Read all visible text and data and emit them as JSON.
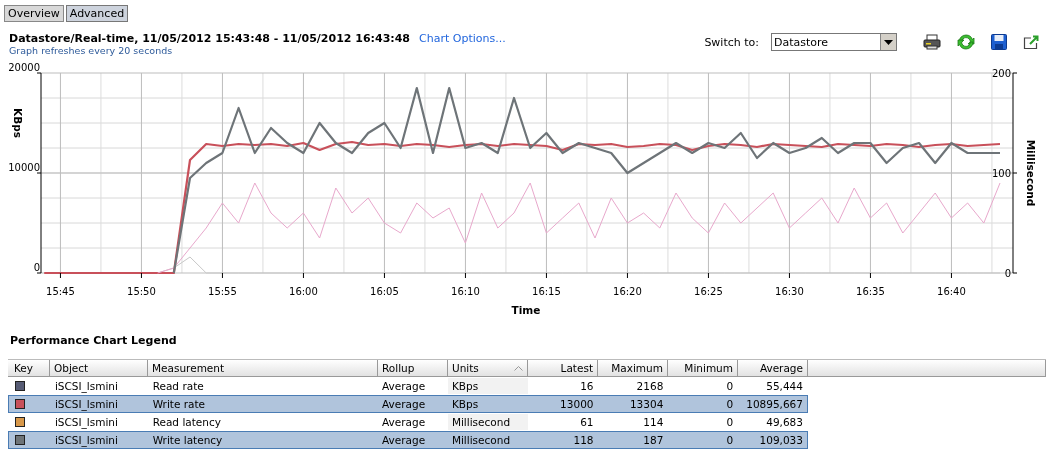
{
  "tabs": [
    {
      "label": "Overview",
      "selected": false
    },
    {
      "label": "Advanced",
      "selected": true
    }
  ],
  "header": {
    "title": "Datastore/Real-time, 11/05/2012 15:43:48 - 11/05/2012 16:43:48",
    "chart_options_link": "Chart Options...",
    "refresh_note": "Graph refreshes every 20 seconds",
    "switch_label": "Switch to:",
    "switch_value": "Datastore"
  },
  "chart": {
    "chart_data": {
      "type": "line",
      "xlabel": "Time",
      "ylabel": "KBps",
      "y2label": "Millisecond",
      "grid": true,
      "ylim": [
        0,
        20000
      ],
      "y2lim": [
        0,
        200
      ],
      "yticks": [
        0,
        10000,
        20000
      ],
      "y2ticks": [
        0,
        100,
        200
      ],
      "categories": [
        null,
        "15:45",
        null,
        null,
        null,
        null,
        "15:50",
        null,
        null,
        null,
        null,
        "15:55",
        null,
        null,
        null,
        null,
        "16:00",
        null,
        null,
        null,
        null,
        "16:05",
        null,
        null,
        null,
        null,
        "16:10",
        null,
        null,
        null,
        null,
        "16:15",
        null,
        null,
        null,
        null,
        "16:20",
        null,
        null,
        null,
        null,
        "16:25",
        null,
        null,
        null,
        null,
        "16:30",
        null,
        null,
        null,
        null,
        "16:35",
        null,
        null,
        null,
        null,
        "16:40",
        null,
        null,
        null
      ],
      "series": [
        {
          "name": "Read rate",
          "color": "#c8c8c8",
          "values": [
            null,
            null,
            null,
            null,
            null,
            null,
            null,
            0,
            500,
            1600,
            0,
            0,
            0,
            0,
            0,
            0,
            0,
            0,
            0,
            0,
            0,
            0,
            0,
            0,
            0,
            0,
            0,
            0,
            0,
            0,
            0,
            0,
            0,
            0,
            0,
            0,
            0,
            0,
            0,
            0,
            0,
            0,
            0,
            0,
            0,
            0,
            0,
            0,
            0,
            0,
            0,
            0,
            0,
            0,
            0,
            0,
            0,
            0,
            0,
            0
          ]
        },
        {
          "name": "Write rate",
          "color": "#c8505a",
          "values": [
            0,
            0,
            0,
            0,
            0,
            0,
            0,
            0,
            0,
            11300,
            12900,
            12700,
            12900,
            12800,
            12900,
            12700,
            13000,
            12300,
            12900,
            13100,
            12800,
            12900,
            12700,
            12900,
            12800,
            12600,
            12800,
            12900,
            12700,
            12900,
            12800,
            12700,
            12300,
            12900,
            12800,
            12900,
            12600,
            12700,
            12900,
            12800,
            12300,
            12700,
            12900,
            12800,
            12600,
            12900,
            12800,
            12700,
            12600,
            12900,
            12800,
            12700,
            12900,
            12800,
            12600,
            12800,
            12900,
            12700,
            12800,
            12900
          ]
        },
        {
          "name": "Read latency",
          "color": "#e8a8cc",
          "axis": "y2",
          "values": [
            null,
            null,
            null,
            null,
            null,
            null,
            null,
            0,
            5,
            25,
            45,
            70,
            50,
            90,
            60,
            45,
            60,
            35,
            85,
            60,
            75,
            50,
            40,
            70,
            55,
            65,
            30,
            80,
            45,
            60,
            90,
            40,
            55,
            70,
            35,
            75,
            50,
            60,
            45,
            80,
            55,
            40,
            70,
            50,
            65,
            80,
            45,
            60,
            75,
            50,
            85,
            55,
            70,
            40,
            60,
            80,
            55,
            70,
            50,
            90
          ]
        },
        {
          "name": "Write latency",
          "color": "#6e7478",
          "axis": "y2",
          "values": [
            null,
            null,
            null,
            null,
            null,
            null,
            null,
            null,
            0,
            95,
            110,
            120,
            165,
            120,
            145,
            130,
            120,
            150,
            130,
            120,
            140,
            150,
            125,
            185,
            120,
            185,
            125,
            130,
            120,
            175,
            125,
            140,
            120,
            130,
            125,
            120,
            100,
            110,
            120,
            130,
            120,
            130,
            125,
            140,
            115,
            130,
            120,
            125,
            135,
            120,
            130,
            130,
            110,
            125,
            130,
            110,
            130,
            120,
            120,
            120
          ]
        }
      ]
    }
  },
  "legend": {
    "title": "Performance Chart Legend",
    "columns": [
      "Key",
      "Object",
      "Measurement",
      "Rollup",
      "Units",
      "Latest",
      "Maximum",
      "Minimum",
      "Average"
    ],
    "rows": [
      {
        "color": "#575c75",
        "selected": false,
        "object": "iSCSI_lsmini",
        "rollup": "Average",
        "units": "KBps",
        "latest": "16",
        "maximum": "2168",
        "minimum": "0",
        "average": "55,444"
      },
      {
        "color": "#c8505a",
        "selected": true,
        "object": "iSCSI_lsmini",
        "rollup": "Average",
        "units": "KBps",
        "latest": "13000",
        "maximum": "13304",
        "minimum": "0",
        "average": "10895,667"
      },
      {
        "color": "#d8984a",
        "selected": false,
        "object": "iSCSI_lsmini",
        "rollup": "Average",
        "units": "Millisecond",
        "latest": "61",
        "maximum": "114",
        "minimum": "0",
        "average": "49,683"
      },
      {
        "color": "#6e7478",
        "selected": true,
        "object": "iSCSI_lsmini",
        "rollup": "Average",
        "units": "Millisecond",
        "latest": "118",
        "maximum": "187",
        "minimum": "0",
        "average": "109,033"
      }
    ]
  }
}
